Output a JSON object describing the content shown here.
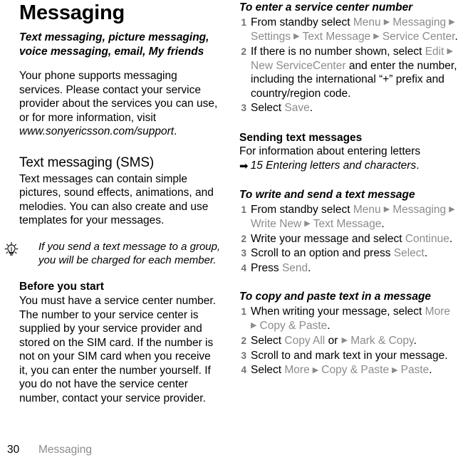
{
  "document": {
    "title": "Messaging",
    "lede": "Text messaging, picture messaging, voice messaging, email, My friends",
    "intro_1": "Your phone supports messaging services. Please contact your service provider about the services you can use, or for more information, visit ",
    "intro_url": "www.sonyericsson.com/support",
    "intro_end": "."
  },
  "sms_section": {
    "heading": "Text messaging (SMS)",
    "body": "Text messages can contain simple pictures, sound effects, animations, and melodies. You can also create and use templates for your messages.",
    "tip_icon": "lightbulb-icon",
    "tip": "If you send a text message to a group, you will be charged for each member.",
    "before_heading": "Before you start",
    "before_body": "You must have a service center number. The number to your service center is supplied by your service provider and stored on the SIM card. If the number is not on your SIM card when you receive it, you can enter the number yourself. If you do not have the service center number, contact your service provider."
  },
  "procedure_service_center": {
    "title": "To enter a service center number",
    "steps": [
      {
        "num": "1",
        "parts": [
          {
            "t": "From standby select ",
            "s": "plain"
          },
          {
            "t": "Menu",
            "s": "ui"
          },
          {
            "t": "▶",
            "s": "arrow"
          },
          {
            "t": "Messaging",
            "s": "ui"
          },
          {
            "t": "▶",
            "s": "arrow"
          },
          {
            "t": "Settings",
            "s": "ui"
          },
          {
            "t": "▶",
            "s": "arrow"
          },
          {
            "t": "Text Message",
            "s": "ui"
          },
          {
            "t": "▶",
            "s": "arrow"
          },
          {
            "t": "Service Center",
            "s": "ui"
          },
          {
            "t": ".",
            "s": "plain"
          }
        ]
      },
      {
        "num": "2",
        "parts": [
          {
            "t": "If there is no number shown, select ",
            "s": "plain"
          },
          {
            "t": "Edit",
            "s": "ui"
          },
          {
            "t": "▶",
            "s": "arrow"
          },
          {
            "t": "New ServiceCenter",
            "s": "ui"
          },
          {
            "t": " and enter the number, including the international “+” prefix and country/region code.",
            "s": "plain"
          }
        ]
      },
      {
        "num": "3",
        "parts": [
          {
            "t": "Select ",
            "s": "plain"
          },
          {
            "t": "Save",
            "s": "ui"
          },
          {
            "t": ".",
            "s": "plain"
          }
        ]
      }
    ]
  },
  "sending_section": {
    "heading": "Sending text messages",
    "body": "For information about entering letters",
    "xref_icon": "➡",
    "xref": "15 Entering letters and characters",
    "xref_end": "."
  },
  "procedure_write_send": {
    "title": "To write and send a text message",
    "steps": [
      {
        "num": "1",
        "parts": [
          {
            "t": "From standby select ",
            "s": "plain"
          },
          {
            "t": "Menu",
            "s": "ui"
          },
          {
            "t": "▶",
            "s": "arrow"
          },
          {
            "t": "Messaging",
            "s": "ui"
          },
          {
            "t": "▶",
            "s": "arrow"
          },
          {
            "t": "Write New",
            "s": "ui"
          },
          {
            "t": "▶",
            "s": "arrow"
          },
          {
            "t": "Text Message",
            "s": "ui"
          },
          {
            "t": ".",
            "s": "plain"
          }
        ]
      },
      {
        "num": "2",
        "parts": [
          {
            "t": "Write your message and select ",
            "s": "plain"
          },
          {
            "t": "Continue",
            "s": "ui"
          },
          {
            "t": ".",
            "s": "plain"
          }
        ]
      },
      {
        "num": "3",
        "parts": [
          {
            "t": "Scroll to an option and press ",
            "s": "plain"
          },
          {
            "t": "Select",
            "s": "ui"
          },
          {
            "t": ".",
            "s": "plain"
          }
        ]
      },
      {
        "num": "4",
        "parts": [
          {
            "t": "Press ",
            "s": "plain"
          },
          {
            "t": "Send",
            "s": "ui"
          },
          {
            "t": ".",
            "s": "plain"
          }
        ]
      }
    ]
  },
  "procedure_copy_paste": {
    "title": "To copy and paste text in a message",
    "steps": [
      {
        "num": "1",
        "parts": [
          {
            "t": "When writing your message, select ",
            "s": "plain"
          },
          {
            "t": "More",
            "s": "ui"
          },
          {
            "t": "▶",
            "s": "arrow"
          },
          {
            "t": "Copy & Paste",
            "s": "ui"
          },
          {
            "t": ".",
            "s": "plain"
          }
        ]
      },
      {
        "num": "2",
        "parts": [
          {
            "t": "Select ",
            "s": "plain"
          },
          {
            "t": "Copy All",
            "s": "ui"
          },
          {
            "t": " or ",
            "s": "plain"
          },
          {
            "t": "▶",
            "s": "arrow"
          },
          {
            "t": "Mark & Copy",
            "s": "ui"
          },
          {
            "t": ".",
            "s": "plain"
          }
        ]
      },
      {
        "num": "3",
        "parts": [
          {
            "t": "Scroll to and mark text in your message.",
            "s": "plain"
          }
        ]
      },
      {
        "num": "4",
        "parts": [
          {
            "t": "Select ",
            "s": "plain"
          },
          {
            "t": "More",
            "s": "ui"
          },
          {
            "t": "▶",
            "s": "arrow"
          },
          {
            "t": "Copy & Paste",
            "s": "ui"
          },
          {
            "t": "▶",
            "s": "arrow"
          },
          {
            "t": "Paste",
            "s": "ui"
          },
          {
            "t": ".",
            "s": "plain"
          }
        ]
      }
    ]
  },
  "footer": {
    "page_number": "30",
    "chapter": "Messaging"
  },
  "colors": {
    "text": "#000000",
    "ui_term": "#8c8c8c",
    "step_number": "#6f6f6f",
    "footer_chapter": "#8c8c8c"
  }
}
